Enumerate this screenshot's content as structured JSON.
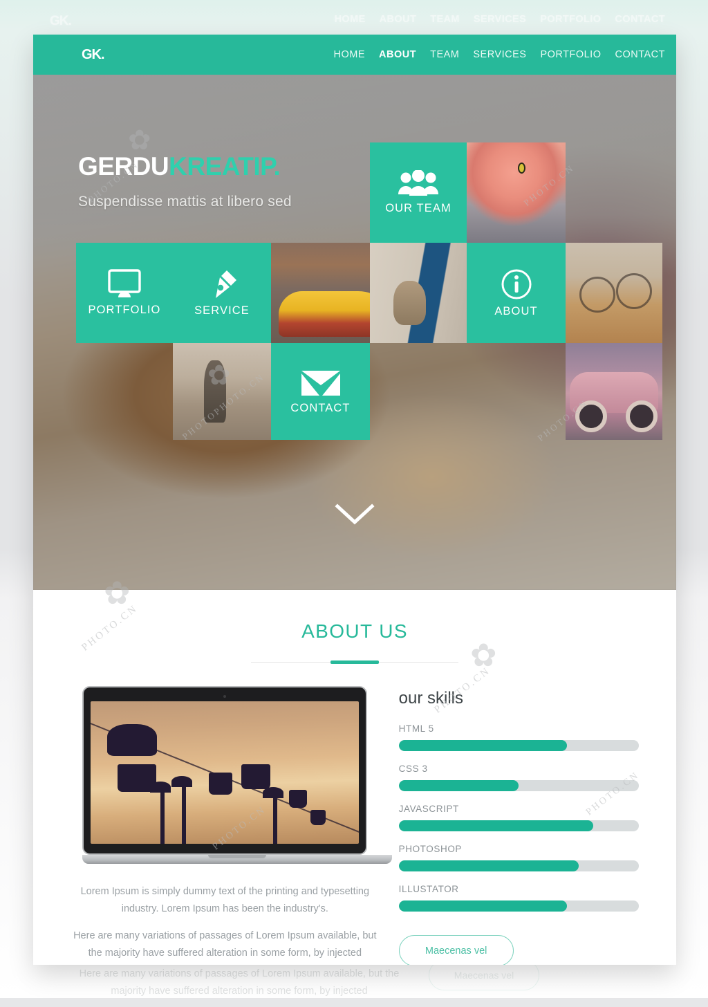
{
  "ghost_nav": {
    "logo": "GK.",
    "items": [
      "HOME",
      "ABOUT",
      "TEAM",
      "SERVICES",
      "PORTFOLIO",
      "CONTACT"
    ],
    "active": "ABOUT"
  },
  "topnav": {
    "logo": "GK.",
    "items": [
      "HOME",
      "ABOUT",
      "TEAM",
      "SERVICES",
      "PORTFOLIO",
      "CONTACT"
    ],
    "active": "ABOUT"
  },
  "hero": {
    "title_white": "GERDU",
    "title_green": "KREATIP.",
    "subtitle": "Suspendisse mattis at libero sed",
    "scroll_icon": "chevron-down-icon",
    "tiles": [
      {
        "label": "OUR TEAM",
        "icon": "people-icon",
        "type": "green"
      },
      {
        "label": "PORTFOLIO",
        "icon": "monitor-icon",
        "type": "green"
      },
      {
        "label": "SERVICE",
        "icon": "pen-nib-icon",
        "type": "green"
      },
      {
        "label": "ABOUT",
        "icon": "info-circle-icon",
        "type": "green"
      },
      {
        "label": "CONTACT",
        "icon": "envelope-icon",
        "type": "green"
      }
    ]
  },
  "about": {
    "heading": "ABOUT US",
    "paragraphs": [
      "Lorem Ipsum is simply dummy text of the printing and typesetting industry. Lorem Ipsum has been the industry's.",
      "Here are many variations of passages of Lorem Ipsum available, but the majority have suffered alteration in some form, by injected humour, or randomised words which don't look."
    ],
    "skills_heading": "our skills",
    "skills": [
      {
        "name": "HTML 5",
        "value": 70
      },
      {
        "name": "CSS 3",
        "value": 50
      },
      {
        "name": "JAVASCRIPT",
        "value": 81
      },
      {
        "name": "PHOTOSHOP",
        "value": 75
      },
      {
        "name": "ILLUSTATOR",
        "value": 70
      }
    ],
    "cta_label": "Maecenas vel"
  },
  "ghost_bottom": {
    "paragraph": "Here are many variations of passages of Lorem Ipsum available, but the majority have suffered alteration in some form, by injected",
    "cta_label": "Maecenas vel"
  },
  "watermarks": [
    "PHOTO.CN",
    "PHOTOPHOTO.CN",
    "PHOTO.CN",
    "PHOTO.CN",
    "PHOTO.CN"
  ],
  "colors": {
    "brand_green": "#27b99a",
    "tile_green": "#2ac09f",
    "bar_fill": "#1bb394",
    "bar_track": "#d8dcdd",
    "page_bg": "#e3e4e6",
    "body_text": "#9aa0a4"
  }
}
